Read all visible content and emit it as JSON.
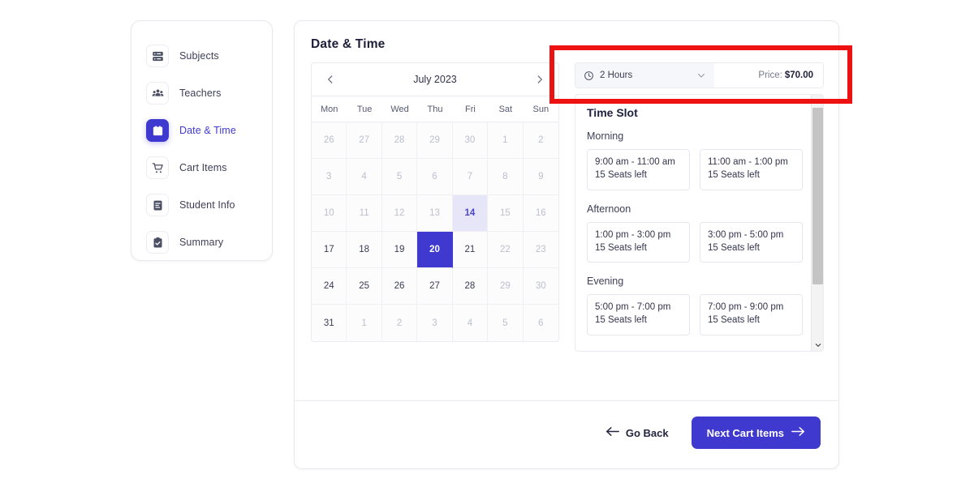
{
  "sidebar": {
    "items": [
      {
        "label": "Subjects",
        "icon": "server-list-icon",
        "active": false
      },
      {
        "label": "Teachers",
        "icon": "people-group-icon",
        "active": false
      },
      {
        "label": "Date & Time",
        "icon": "calendar-icon",
        "active": true
      },
      {
        "label": "Cart Items",
        "icon": "shopping-cart-icon",
        "active": false
      },
      {
        "label": "Student Info",
        "icon": "document-text-icon",
        "active": false
      },
      {
        "label": "Summary",
        "icon": "clipboard-check-icon",
        "active": false
      }
    ]
  },
  "main": {
    "title": "Date & Time"
  },
  "calendar": {
    "prev_icon": "chevron-left-icon",
    "next_icon": "chevron-right-icon",
    "month_label": "July 2023",
    "weekdays": [
      "Mon",
      "Tue",
      "Wed",
      "Thu",
      "Fri",
      "Sat",
      "Sun"
    ],
    "selected_day": 20,
    "today_day": 14,
    "weeks": [
      [
        {
          "d": "26",
          "state": "muted"
        },
        {
          "d": "27",
          "state": "muted"
        },
        {
          "d": "28",
          "state": "muted"
        },
        {
          "d": "29",
          "state": "muted"
        },
        {
          "d": "30",
          "state": "muted"
        },
        {
          "d": "1",
          "state": "muted"
        },
        {
          "d": "2",
          "state": "muted"
        }
      ],
      [
        {
          "d": "3",
          "state": "muted"
        },
        {
          "d": "4",
          "state": "muted"
        },
        {
          "d": "5",
          "state": "muted"
        },
        {
          "d": "6",
          "state": "muted"
        },
        {
          "d": "7",
          "state": "muted"
        },
        {
          "d": "8",
          "state": "muted"
        },
        {
          "d": "9",
          "state": "muted"
        }
      ],
      [
        {
          "d": "10",
          "state": "muted"
        },
        {
          "d": "11",
          "state": "muted"
        },
        {
          "d": "12",
          "state": "muted"
        },
        {
          "d": "13",
          "state": "muted"
        },
        {
          "d": "14",
          "state": "today"
        },
        {
          "d": "15",
          "state": "muted"
        },
        {
          "d": "16",
          "state": "muted"
        }
      ],
      [
        {
          "d": "17",
          "state": "normal"
        },
        {
          "d": "18",
          "state": "normal"
        },
        {
          "d": "19",
          "state": "normal"
        },
        {
          "d": "20",
          "state": "selected"
        },
        {
          "d": "21",
          "state": "normal"
        },
        {
          "d": "22",
          "state": "muted"
        },
        {
          "d": "23",
          "state": "muted"
        }
      ],
      [
        {
          "d": "24",
          "state": "normal"
        },
        {
          "d": "25",
          "state": "normal"
        },
        {
          "d": "26",
          "state": "normal"
        },
        {
          "d": "27",
          "state": "normal"
        },
        {
          "d": "28",
          "state": "normal"
        },
        {
          "d": "29",
          "state": "muted"
        },
        {
          "d": "30",
          "state": "muted"
        }
      ],
      [
        {
          "d": "31",
          "state": "normal"
        },
        {
          "d": "1",
          "state": "muted"
        },
        {
          "d": "2",
          "state": "muted"
        },
        {
          "d": "3",
          "state": "muted"
        },
        {
          "d": "4",
          "state": "muted"
        },
        {
          "d": "5",
          "state": "muted"
        },
        {
          "d": "6",
          "state": "muted"
        }
      ]
    ]
  },
  "duration": {
    "clock_icon": "clock-icon",
    "chevron_icon": "chevron-down-icon",
    "selected": "2 Hours",
    "price_label": "Price:",
    "price_value": "$70.00"
  },
  "time_slot": {
    "title": "Time Slot",
    "groups": [
      {
        "label": "Morning",
        "slots": [
          {
            "time": "9:00 am - 11:00 am",
            "seats": "15 Seats left"
          },
          {
            "time": "11:00 am - 1:00 pm",
            "seats": "15 Seats left"
          }
        ]
      },
      {
        "label": "Afternoon",
        "slots": [
          {
            "time": "1:00 pm - 3:00 pm",
            "seats": "15 Seats left"
          },
          {
            "time": "3:00 pm - 5:00 pm",
            "seats": "15 Seats left"
          }
        ]
      },
      {
        "label": "Evening",
        "slots": [
          {
            "time": "5:00 pm - 7:00 pm",
            "seats": "15 Seats left"
          },
          {
            "time": "7:00 pm - 9:00 pm",
            "seats": "15 Seats left"
          }
        ]
      }
    ],
    "scrollbar": {
      "up_icon": "caret-up-icon",
      "down_icon": "caret-down-icon"
    }
  },
  "footer": {
    "back_arrow_icon": "arrow-left-icon",
    "back_label": "Go Back",
    "next_label": "Next Cart Items",
    "next_arrow_icon": "arrow-right-icon"
  },
  "annotation": {
    "color": "#ee1111",
    "target": "duration-and-price-row"
  }
}
